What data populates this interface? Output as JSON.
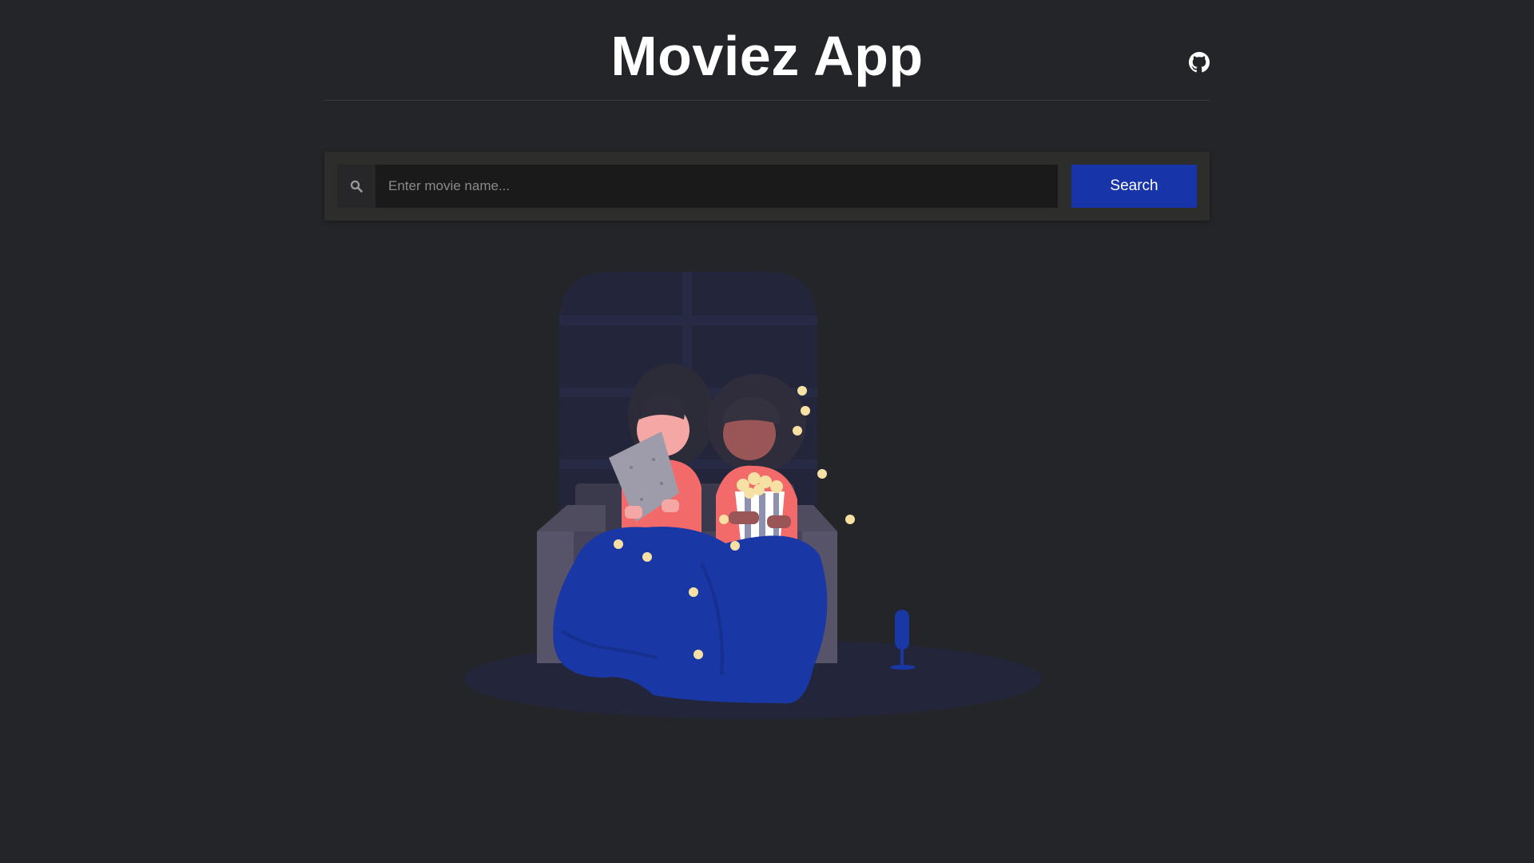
{
  "header": {
    "title": "Moviez App",
    "github_icon": "github-icon"
  },
  "search": {
    "icon": "search-icon",
    "placeholder": "Enter movie name...",
    "value": "",
    "button_label": "Search"
  },
  "illustration": {
    "name": "watching-movie-illustration"
  },
  "colors": {
    "background": "#242528",
    "panel": "#2d2d2c",
    "input": "#1a1a1a",
    "accent": "#1735a8",
    "text": "#ffffff"
  }
}
